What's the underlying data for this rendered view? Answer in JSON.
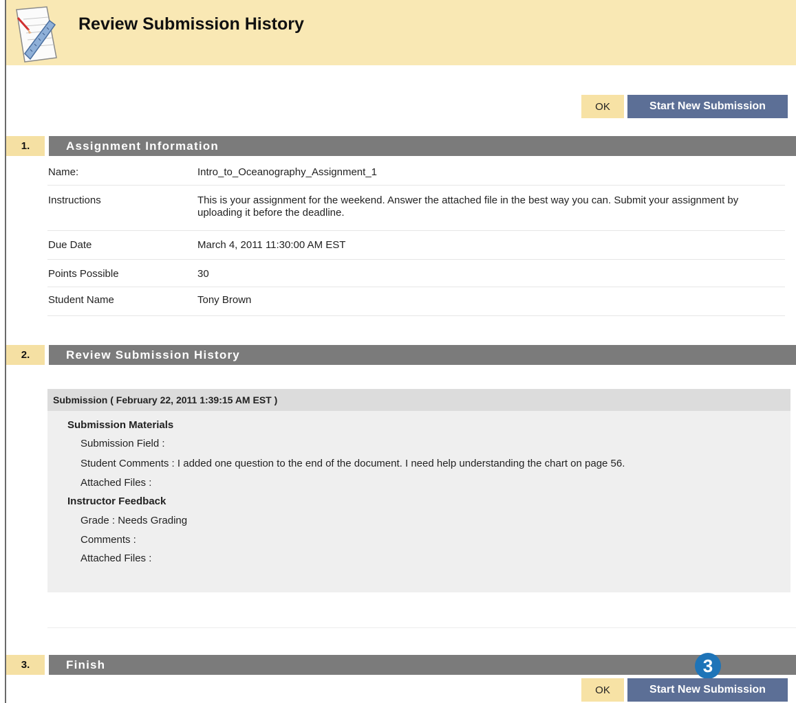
{
  "header": {
    "title": "Review Submission History",
    "icon": "assignment-ruler-icon"
  },
  "actions": {
    "ok_label": "OK",
    "start_label": "Start New Submission"
  },
  "sections": [
    {
      "number": "1.",
      "title": "Assignment Information"
    },
    {
      "number": "2.",
      "title": "Review Submission History"
    },
    {
      "number": "3.",
      "title": "Finish"
    }
  ],
  "assignment_info": [
    {
      "label": "Name:",
      "value": "Intro_to_Oceanography_Assignment_1"
    },
    {
      "label": "Instructions",
      "value": "This is your assignment for the weekend. Answer the attached file in the best way you can. Submit your assignment by uploading it before the deadline."
    },
    {
      "label": "Due Date",
      "value": "March 4, 2011 11:30:00 AM EST"
    },
    {
      "label": "Points Possible",
      "value": "30"
    },
    {
      "label": "Student Name",
      "value": "Tony Brown"
    }
  ],
  "submission": {
    "heading": "Submission ( February 22, 2011 1:39:15 AM EST )",
    "materials_heading": "Submission Materials",
    "submission_field": "Submission Field :",
    "student_comments": "Student Comments : I added one question to the end of the document. I need help understanding the chart on page 56.",
    "attached_files": "Attached Files :",
    "feedback_heading": "Instructor Feedback",
    "grade": "Grade : Needs Grading",
    "comments": "Comments :",
    "feedback_attached_files": "Attached Files :"
  },
  "callout": {
    "label": "3",
    "color": "#1e74b8"
  },
  "colors": {
    "header_bg": "#f9e8b4",
    "primary_button": "#5c6f96",
    "section_bar": "#7b7b7b",
    "step_number_bg": "#f5e0a3"
  }
}
